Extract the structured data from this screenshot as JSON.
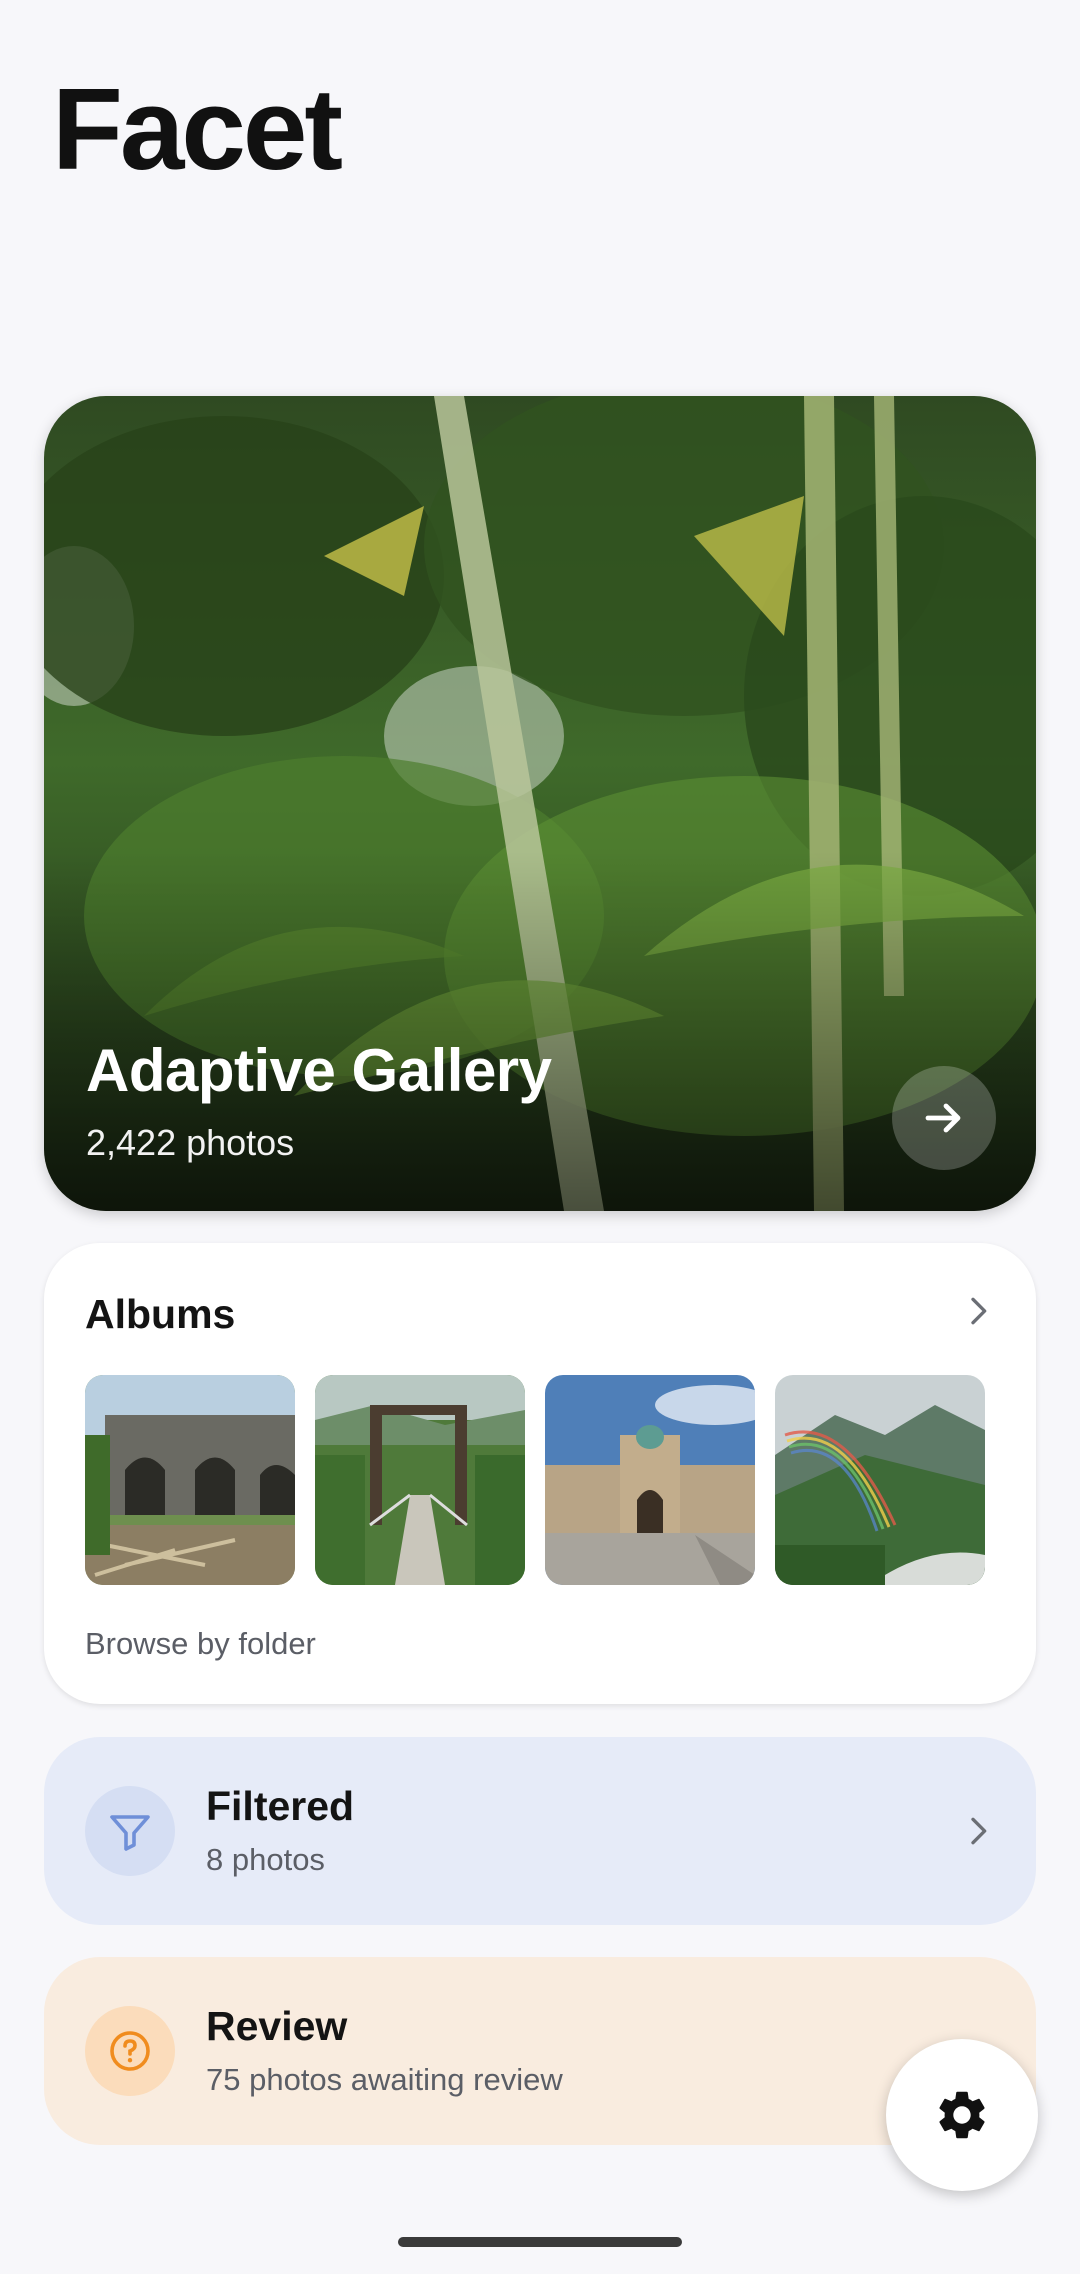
{
  "app": {
    "title": "Facet"
  },
  "hero": {
    "title": "Adaptive Gallery",
    "subtitle": "2,422 photos",
    "arrow_icon": "arrow-right-icon"
  },
  "albums": {
    "title": "Albums",
    "chevron_icon": "chevron-right-icon",
    "caption": "Browse by folder",
    "thumbnails": [
      "stone-aqueduct",
      "suspension-bridge",
      "fortress-gate",
      "rainbow-valley"
    ]
  },
  "filtered": {
    "title": "Filtered",
    "subtitle": "8 photos",
    "icon": "filter-icon",
    "accent": "#6f8fd8"
  },
  "review": {
    "title": "Review",
    "subtitle": "75 photos awaiting review",
    "icon": "question-circle-icon",
    "accent": "#f08c1e"
  },
  "fab": {
    "icon": "gear-icon"
  }
}
